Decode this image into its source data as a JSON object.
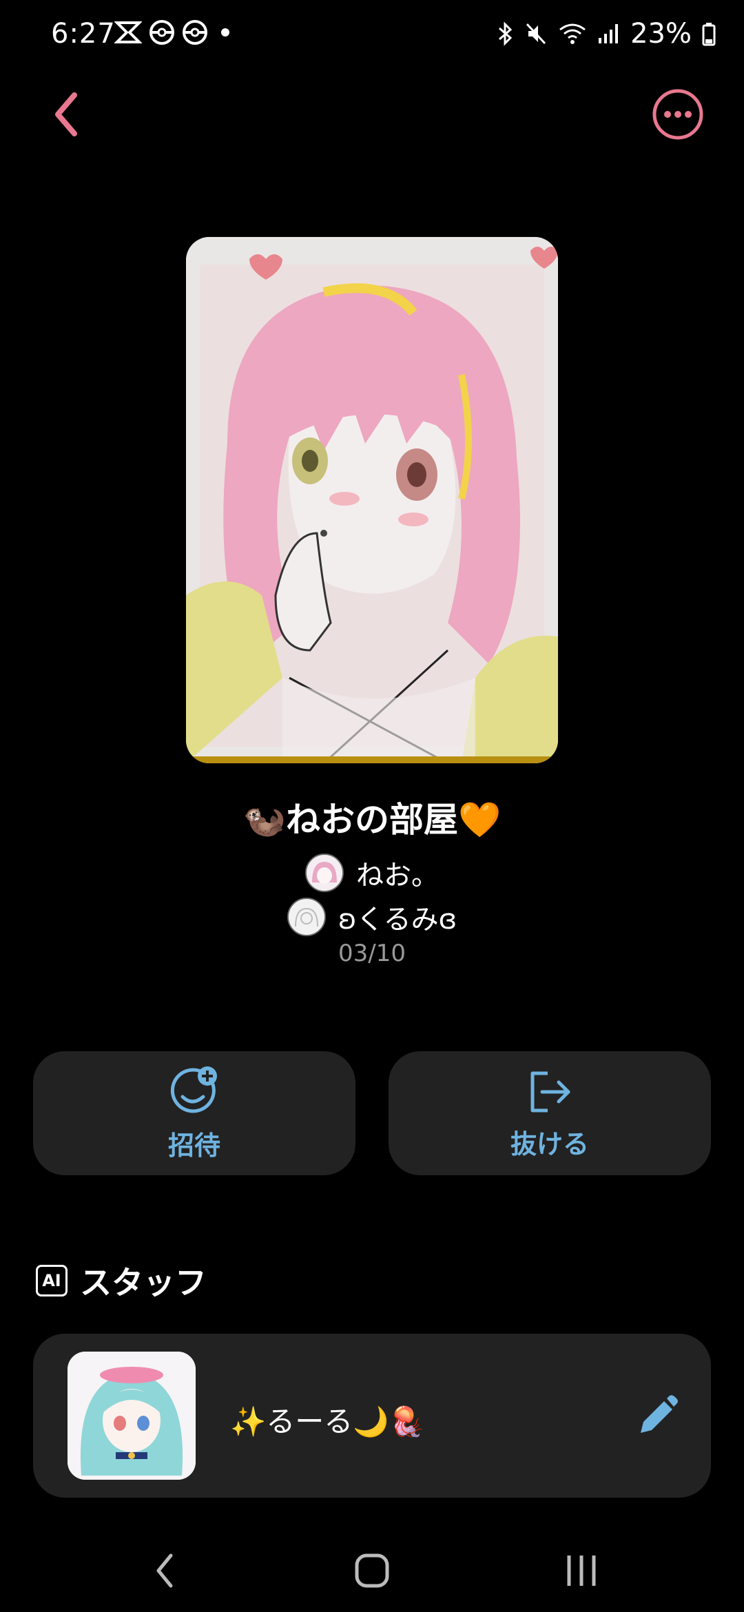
{
  "status_bar": {
    "time": "6:27",
    "battery": "23%",
    "left_icons": [
      "capcut-icon",
      "pokeball-icon",
      "pokeball-icon",
      "dot-icon"
    ],
    "right_icons": [
      "bluetooth-icon",
      "mute-icon",
      "wifi-icon",
      "signal-icon",
      "battery-icon"
    ]
  },
  "nav": {
    "back_icon": "chevron-left-icon",
    "more_icon": "more-icon",
    "accent": "#e8788f"
  },
  "room": {
    "title": "🦦ねおの部屋🧡",
    "members": [
      {
        "name": "ねお。"
      },
      {
        "name": "ʚくるみɞ"
      }
    ],
    "date": "03/10"
  },
  "actions": {
    "invite_label": "招待",
    "leave_label": "抜ける",
    "accent": "#6fb3e0"
  },
  "staff": {
    "badge": "AI",
    "header": "スタッフ",
    "name": "✨るーる🌙🪼"
  }
}
